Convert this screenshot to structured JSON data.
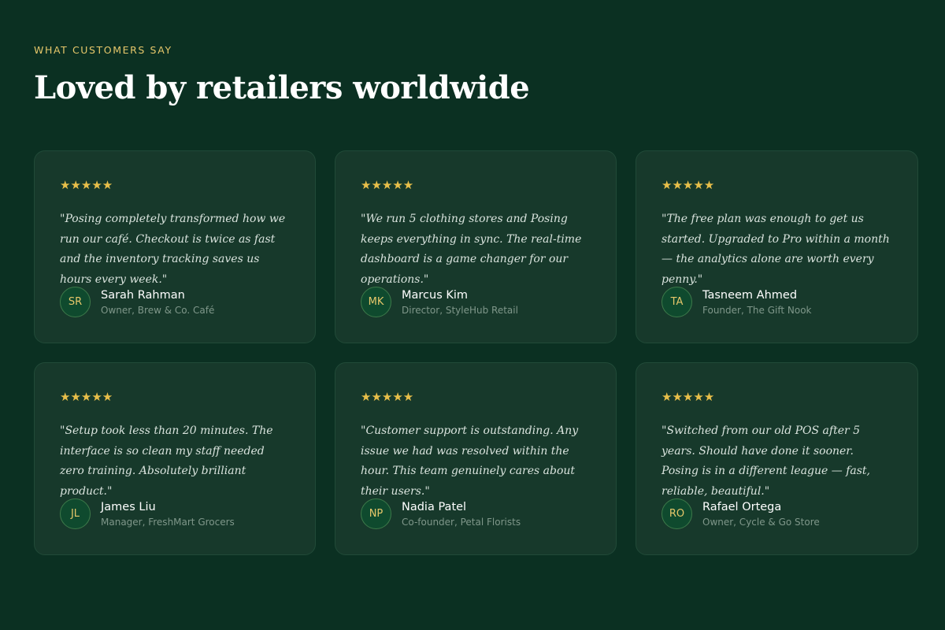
{
  "section": {
    "eyebrow": "WHAT CUSTOMERS SAY",
    "title": "Loved by retailers worldwide"
  },
  "colors": {
    "background": "#0b3022",
    "card": "#17392b",
    "accent": "#e6c76a",
    "star": "#e8bf4a"
  },
  "testimonials": [
    {
      "rating": 5,
      "stars": "★★★★★",
      "quote": "\"Posing completely transformed how we run our café. Checkout is twice as fast and the inventory tracking saves us hours every week.\"",
      "initials": "SR",
      "name": "Sarah Rahman",
      "role": "Owner, Brew & Co. Café"
    },
    {
      "rating": 5,
      "stars": "★★★★★",
      "quote": "\"We run 5 clothing stores and Posing keeps everything in sync. The real-time dashboard is a game changer for our operations.\"",
      "initials": "MK",
      "name": "Marcus Kim",
      "role": "Director, StyleHub Retail"
    },
    {
      "rating": 5,
      "stars": "★★★★★",
      "quote": "\"The free plan was enough to get us started. Upgraded to Pro within a month — the analytics alone are worth every penny.\"",
      "initials": "TA",
      "name": "Tasneem Ahmed",
      "role": "Founder, The Gift Nook"
    },
    {
      "rating": 5,
      "stars": "★★★★★",
      "quote": "\"Setup took less than 20 minutes. The interface is so clean my staff needed zero training. Absolutely brilliant product.\"",
      "initials": "JL",
      "name": "James Liu",
      "role": "Manager, FreshMart Grocers"
    },
    {
      "rating": 5,
      "stars": "★★★★★",
      "quote": "\"Customer support is outstanding. Any issue we had was resolved within the hour. This team genuinely cares about their users.\"",
      "initials": "NP",
      "name": "Nadia Patel",
      "role": "Co-founder, Petal Florists"
    },
    {
      "rating": 5,
      "stars": "★★★★★",
      "quote": "\"Switched from our old POS after 5 years. Should have done it sooner. Posing is in a different league — fast, reliable, beautiful.\"",
      "initials": "RO",
      "name": "Rafael Ortega",
      "role": "Owner, Cycle & Go Store"
    }
  ]
}
